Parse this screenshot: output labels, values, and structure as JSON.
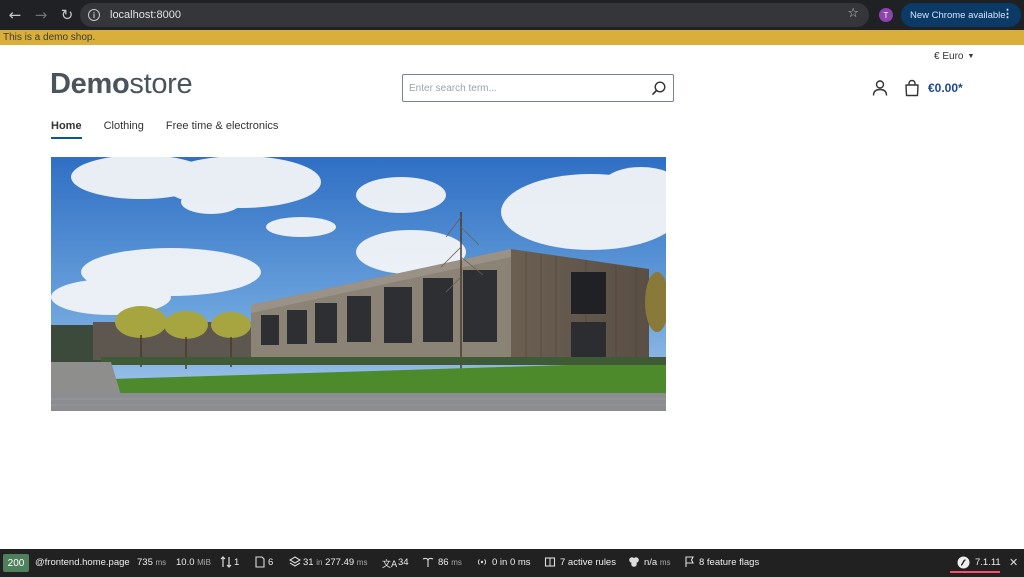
{
  "browser": {
    "url": "localhost:8000",
    "profile_initial": "T",
    "update_label": "New Chrome available",
    "icons": [
      "back-icon",
      "forward-icon",
      "reload-icon",
      "info-icon",
      "star-icon",
      "menu-icon"
    ]
  },
  "banner": {
    "text": "This is a demo shop."
  },
  "header": {
    "currency": "€ Euro",
    "logo_bold": "Demo",
    "logo_light": "store",
    "search_placeholder": "Enter search term...",
    "cart_total": "€0.00*"
  },
  "nav": {
    "items": [
      {
        "label": "Home",
        "active": true
      },
      {
        "label": "Clothing",
        "active": false
      },
      {
        "label": "Free time & electronics",
        "active": false
      }
    ]
  },
  "profiler": {
    "status": "200",
    "route": "@frontend.home.page",
    "time_value": "735",
    "time_unit": "ms",
    "memory_value": "10.0",
    "memory_unit": "MiB",
    "requests": "1",
    "templates": "6",
    "cache_count": "31",
    "cache_in": "in",
    "cache_time": "277.49",
    "cache_unit": "ms",
    "translations": "34",
    "events_value": "86",
    "events_unit": "ms",
    "db_value": "0 in 0 ms",
    "rules": "7 active rules",
    "twig_value": "n/a",
    "twig_unit": "ms",
    "feature_flags": "8 feature flags",
    "version": "7.1.11"
  },
  "colors": {
    "chrome_bg": "#202124",
    "banner_bg": "#d9ae3a",
    "brand_blue": "#1c4690",
    "profiler_bg": "#212121",
    "status_green": "#4f805d"
  }
}
